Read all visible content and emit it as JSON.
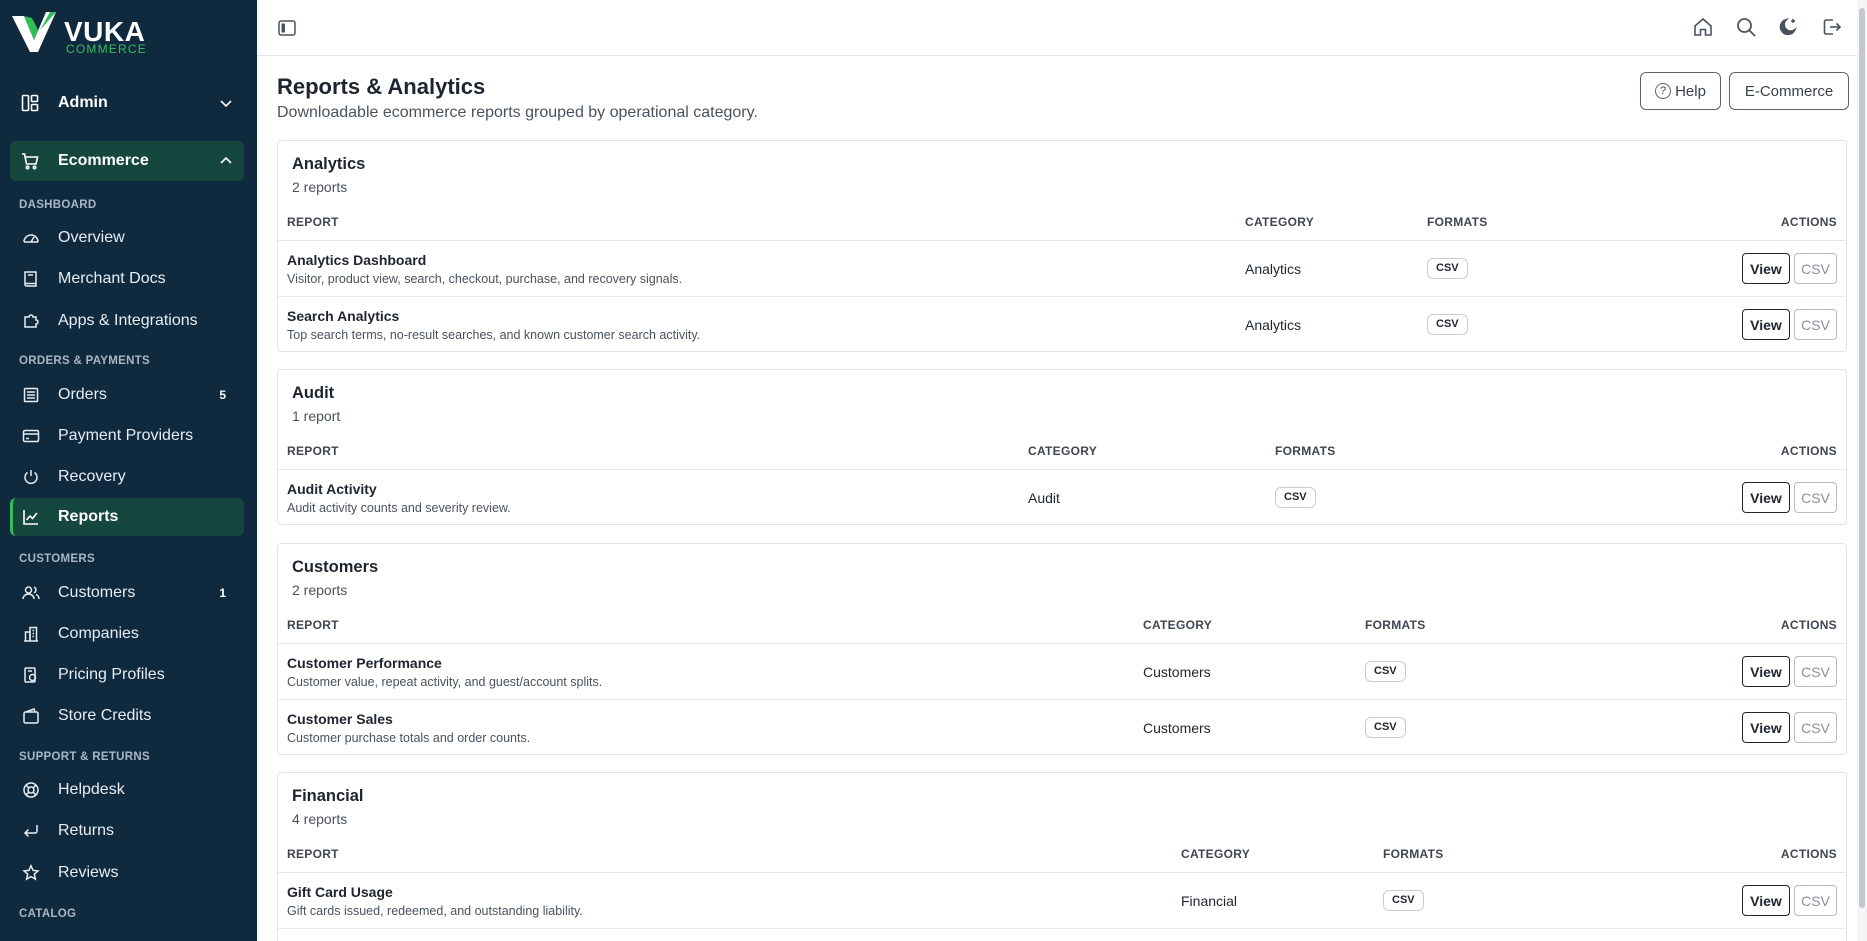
{
  "sidebar": {
    "brand": "VUKA",
    "brand_sub": "COMMERCE",
    "admin_label": "Admin",
    "ecommerce_label": "Ecommerce",
    "sections": {
      "dashboard": "DASHBOARD",
      "orders_payments": "ORDERS & PAYMENTS",
      "customers": "CUSTOMERS",
      "support_returns": "SUPPORT & RETURNS",
      "catalog": "CATALOG"
    },
    "items": {
      "overview": "Overview",
      "merchant_docs": "Merchant Docs",
      "apps_integrations": "Apps & Integrations",
      "orders": "Orders",
      "orders_badge": "5",
      "payment_providers": "Payment Providers",
      "recovery": "Recovery",
      "reports": "Reports",
      "customers": "Customers",
      "customers_badge": "1",
      "companies": "Companies",
      "pricing_profiles": "Pricing Profiles",
      "store_credits": "Store Credits",
      "helpdesk": "Helpdesk",
      "returns": "Returns",
      "reviews": "Reviews"
    }
  },
  "header": {
    "title": "Reports & Analytics",
    "subtitle": "Downloadable ecommerce reports grouped by operational category.",
    "help_label": "Help",
    "ecommerce_label": "E-Commerce"
  },
  "columns": {
    "report": "REPORT",
    "category": "CATEGORY",
    "formats": "FORMATS",
    "actions": "ACTIONS"
  },
  "actions": {
    "view": "View",
    "csv": "CSV"
  },
  "groups": [
    {
      "title": "Analytics",
      "count": "2 reports",
      "rows": [
        {
          "name": "Analytics Dashboard",
          "desc": "Visitor, product view, search, checkout, purchase, and recovery signals.",
          "category": "Analytics",
          "format": "CSV"
        },
        {
          "name": "Search Analytics",
          "desc": "Top search terms, no-result searches, and known customer search activity.",
          "category": "Analytics",
          "format": "CSV"
        }
      ]
    },
    {
      "title": "Audit",
      "count": "1 report",
      "rows": [
        {
          "name": "Audit Activity",
          "desc": "Audit activity counts and severity review.",
          "category": "Audit",
          "format": "CSV"
        }
      ]
    },
    {
      "title": "Customers",
      "count": "2 reports",
      "rows": [
        {
          "name": "Customer Performance",
          "desc": "Customer value, repeat activity, and guest/account splits.",
          "category": "Customers",
          "format": "CSV"
        },
        {
          "name": "Customer Sales",
          "desc": "Customer purchase totals and order counts.",
          "category": "Customers",
          "format": "CSV"
        }
      ]
    },
    {
      "title": "Financial",
      "count": "4 reports",
      "rows": [
        {
          "name": "Gift Card Usage",
          "desc": "Gift cards issued, redeemed, and outstanding liability.",
          "category": "Financial",
          "format": "CSV"
        }
      ]
    }
  ],
  "colors": {
    "sidebar_bg": "#0f2a3f",
    "active_bg": "#15473e",
    "accent": "#2fbf5a"
  },
  "icons": {
    "topbar": [
      "sidebar-toggle-icon",
      "home-icon",
      "search-icon",
      "theme-moon-icon",
      "logout-icon"
    ]
  }
}
